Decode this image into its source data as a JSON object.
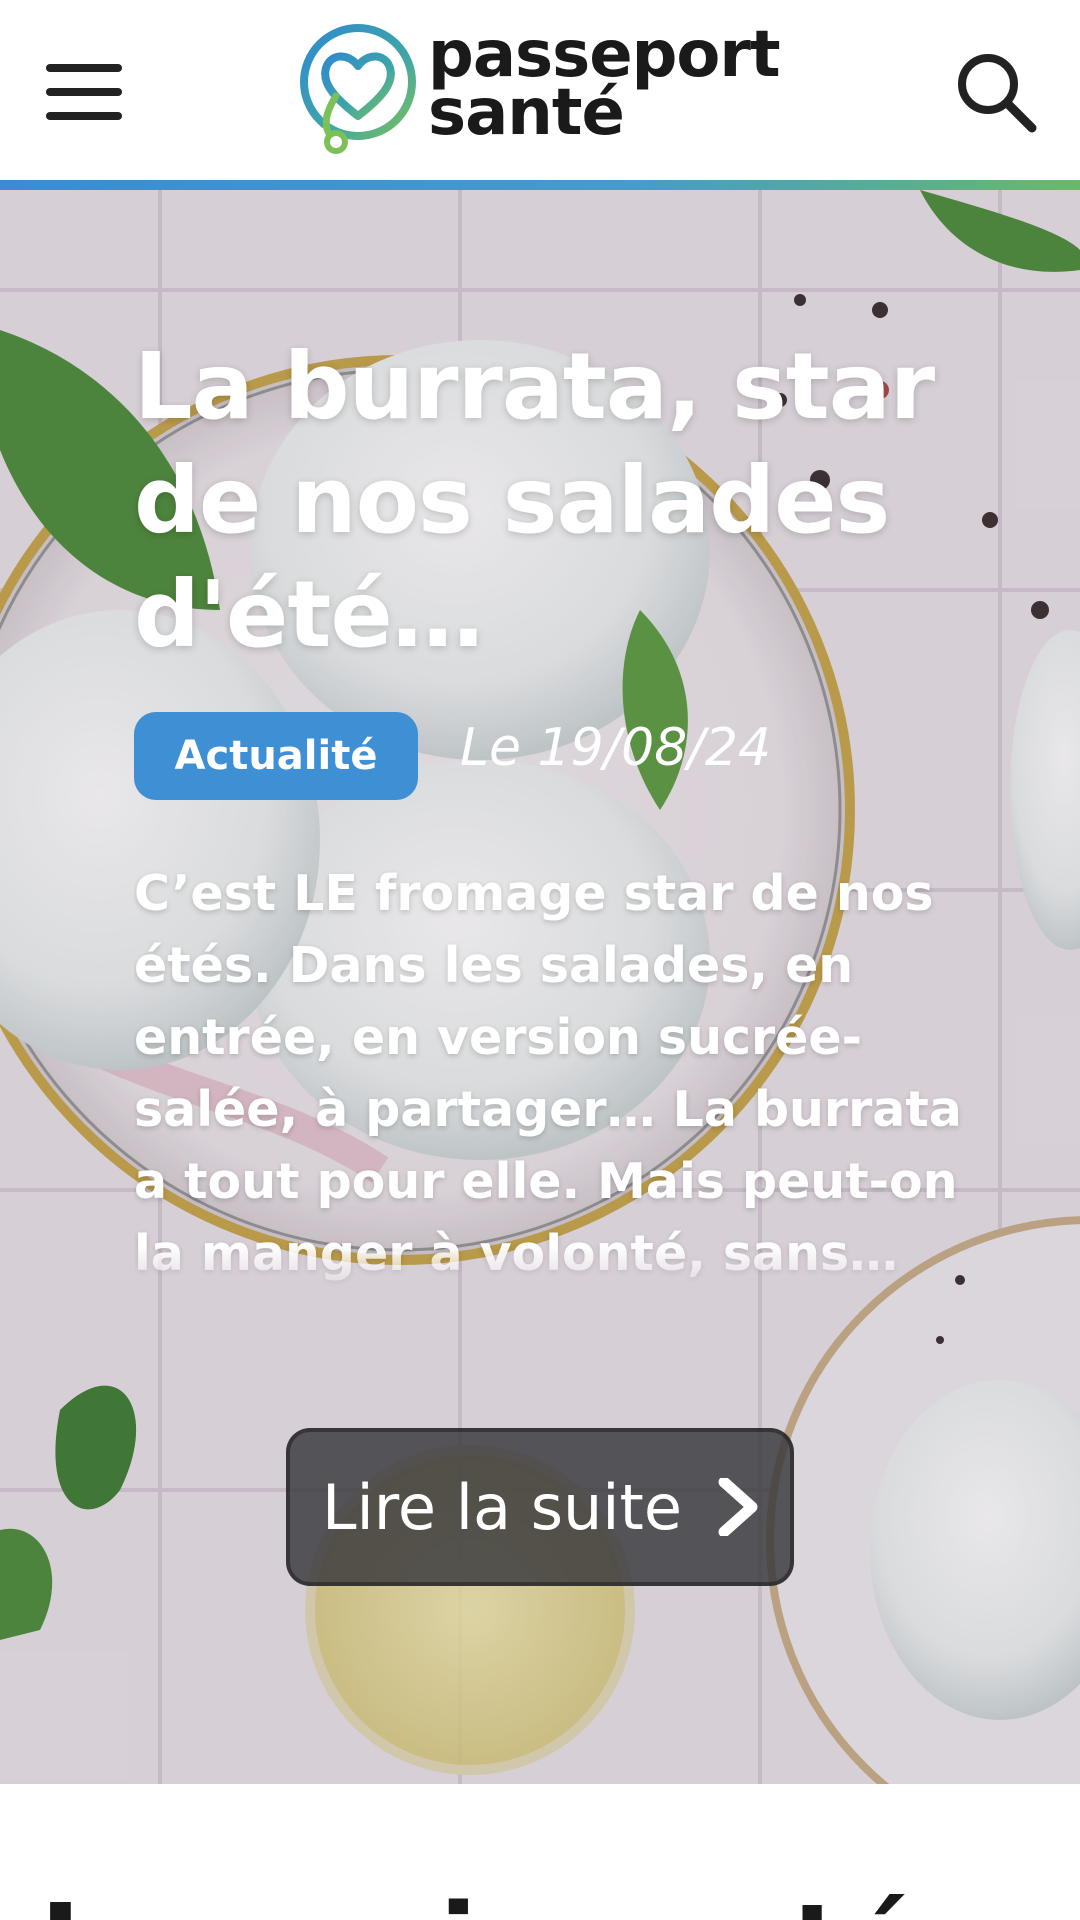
{
  "header": {
    "logo": {
      "line1": "passeport",
      "line2": "santé"
    },
    "colors": {
      "accent_blue": "#3b8bd0",
      "accent_green": "#6bb86a"
    },
    "icons": {
      "menu": "hamburger-icon",
      "search": "search-icon"
    }
  },
  "hero": {
    "title": "La burrata, star de nos salades d'été…",
    "badge": "Actualité",
    "date": "Le 19/08/24",
    "excerpt": "C’est LE fromage star de nos étés. Dans les salades, en entrée, en version sucrée-salée, à partager… La burrata a tout pour elle. Mais peut-on la manger à volonté, sans…",
    "read_more": "Lire la suite",
    "badge_color": "#3f8fd4"
  },
  "next_section": {
    "title": "Les quiz santé"
  }
}
